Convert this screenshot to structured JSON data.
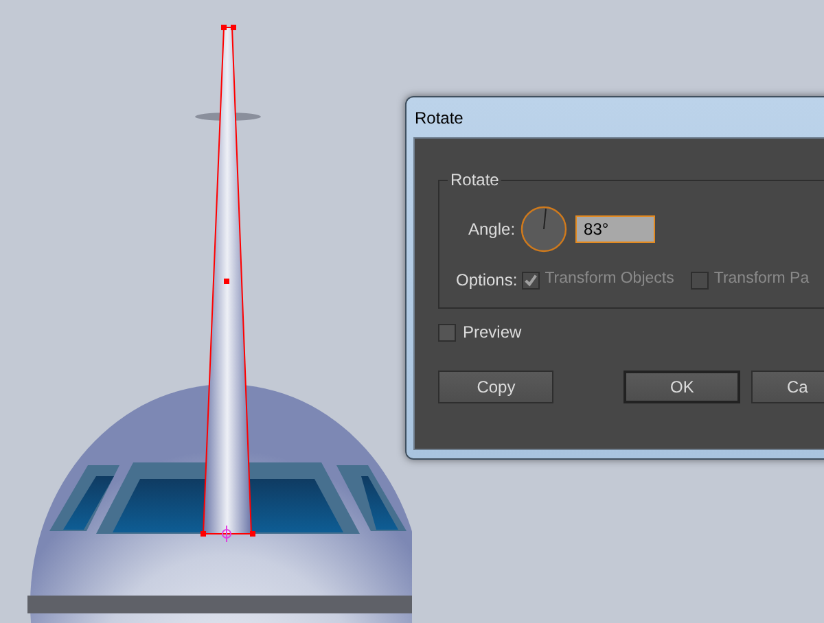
{
  "dialog": {
    "title": "Rotate",
    "group_title": "Rotate",
    "angle": {
      "label": "Angle:",
      "value": "83°"
    },
    "options": {
      "label": "Options:",
      "items": [
        {
          "label": "Transform Objects",
          "checked": true,
          "disabled": true
        },
        {
          "label": "Transform Pa",
          "checked": false,
          "disabled": true
        }
      ]
    },
    "preview": {
      "label": "Preview",
      "checked": false
    },
    "buttons": [
      {
        "label": "Copy",
        "selected": false
      },
      {
        "label": "OK",
        "selected": true
      },
      {
        "label": "Ca",
        "selected": false
      }
    ]
  }
}
